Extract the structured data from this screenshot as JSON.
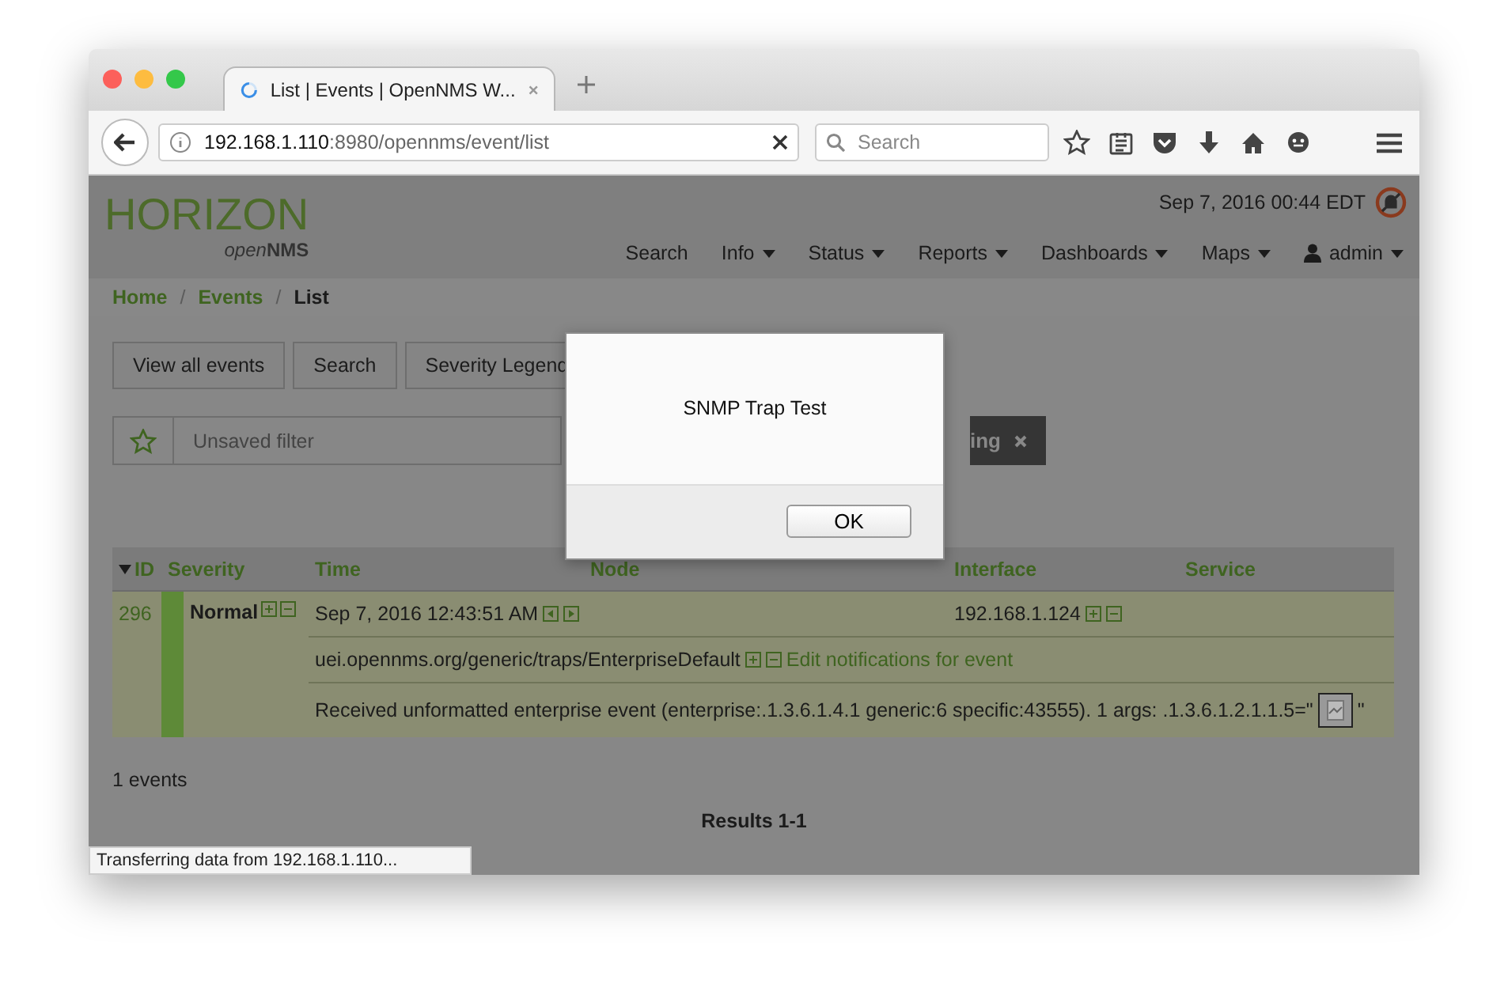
{
  "browser": {
    "tab": {
      "title": "List | Events | OpenNMS W...",
      "loading": true
    },
    "url": {
      "host": "192.168.1.110",
      "rest": ":8980/opennms/event/list"
    },
    "search_placeholder": "Search"
  },
  "header": {
    "logo_top": "HORIZON",
    "logo_open": "open",
    "logo_nms": "NMS",
    "datetime": "Sep 7, 2016 00:44 EDT",
    "nav": [
      {
        "label": "Search",
        "kind": "plain"
      },
      {
        "label": "Info",
        "kind": "dropdown"
      },
      {
        "label": "Status",
        "kind": "dropdown"
      },
      {
        "label": "Reports",
        "kind": "dropdown"
      },
      {
        "label": "Dashboards",
        "kind": "dropdown"
      },
      {
        "label": "Maps",
        "kind": "dropdown"
      },
      {
        "label": "admin",
        "kind": "user"
      }
    ]
  },
  "breadcrumb": [
    {
      "label": "Home",
      "current": false
    },
    {
      "separator": "/",
      "label": "Events",
      "current": false
    },
    {
      "separator": "/",
      "label": "List",
      "current": true
    }
  ],
  "buttons": [
    "View all events",
    "Search",
    "Severity Legend"
  ],
  "filter": {
    "placeholder": "Unsaved filter",
    "chip": "ing"
  },
  "table": {
    "columns": [
      "ID",
      "Severity",
      "Time",
      "Node",
      "Interface",
      "Service"
    ],
    "rows": [
      {
        "id": "296",
        "severity": "Normal",
        "color": "#5e8a38",
        "time": "Sep 7, 2016 12:43:51 AM",
        "interface": "192.168.1.124",
        "uei": "uei.opennms.org/generic/traps/EnterpriseDefault",
        "edit_link": "Edit notifications for event",
        "description": "Received unformatted enterprise event (enterprise:.1.3.6.1.4.1 generic:6 specific:43555). 1 args: .1.3.6.1.2.1.1.5=\"",
        "description_end": "\""
      }
    ]
  },
  "count": "1 events",
  "results": "Results 1-1",
  "status": "Transferring data from 192.168.1.110...",
  "dialog": {
    "message": "SNMP Trap Test",
    "button": "OK"
  }
}
